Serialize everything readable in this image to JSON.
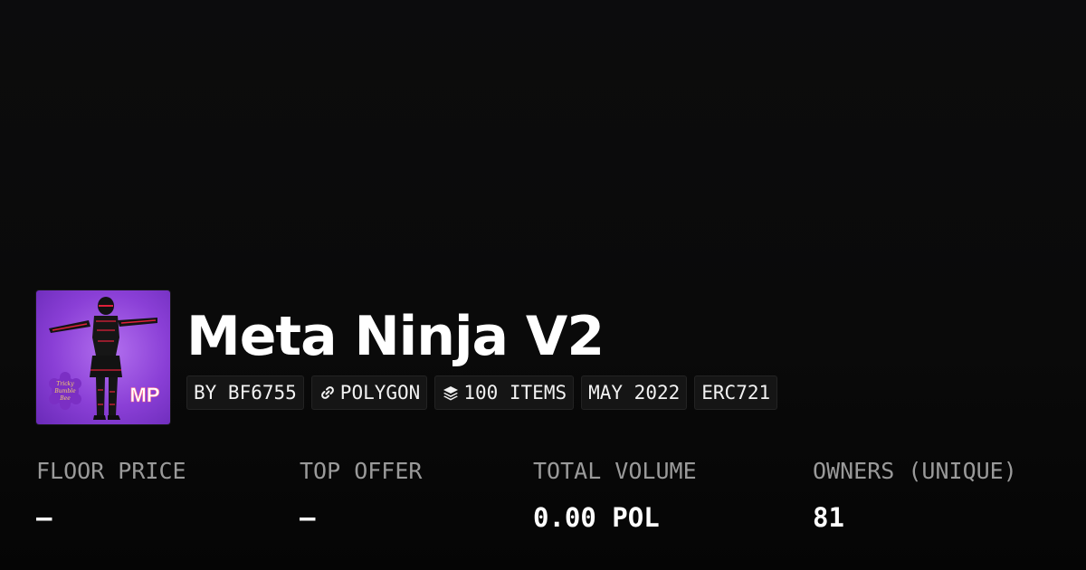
{
  "collection": {
    "title": "Meta Ninja V2",
    "image_logo_text": "MP",
    "image_badge_text": [
      "Tricky",
      "Bumble",
      "Bee"
    ]
  },
  "tags": {
    "creator": "BY BF6755",
    "chain": "POLYGON",
    "items": "100 ITEMS",
    "date": "MAY 2022",
    "standard": "ERC721"
  },
  "icons": {
    "chain": "link-icon",
    "items": "layers-icon"
  },
  "stats": [
    {
      "label": "FLOOR PRICE",
      "value": "–"
    },
    {
      "label": "TOP OFFER",
      "value": "–"
    },
    {
      "label": "TOTAL VOLUME",
      "value": "0.00 POL"
    },
    {
      "label": "OWNERS (UNIQUE)",
      "value": "81"
    }
  ],
  "colors": {
    "background": "#0a0a0a",
    "image_purple": "#8a3fd6",
    "ninja_accent": "#e0203a",
    "tag_background": "#151515",
    "label_gray": "#9a9a9a"
  }
}
